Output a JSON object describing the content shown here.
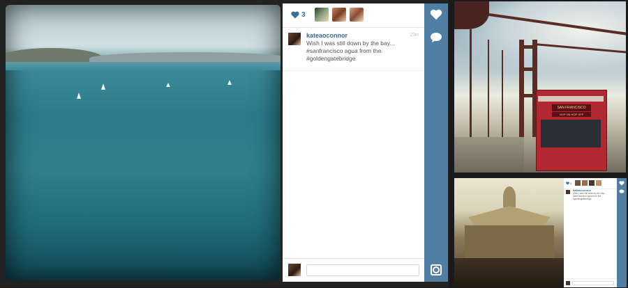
{
  "post": {
    "like_count": "3",
    "username": "kateaoconnor",
    "time_ago": "19m",
    "caption": "Wish I was still down by the bay... #sanfrancisco agua from the #goldengatebridge",
    "comment_placeholder": ""
  },
  "bus_sign": {
    "line1": "SAN FRANCISCO",
    "line2": "HOP ON HOP OFF"
  },
  "mini_post": {
    "like_count": "4",
    "username": "kateaoconnor",
    "caption": "Wish I was still down by the bay... #sanfrancisco agua from the #goldengatebridge"
  },
  "icons": {
    "like": "heart-icon",
    "comment": "speech-bubble-icon",
    "brand": "instagram-camera-icon"
  },
  "colors": {
    "accent": "#517fa4",
    "username": "#3a6d99"
  }
}
